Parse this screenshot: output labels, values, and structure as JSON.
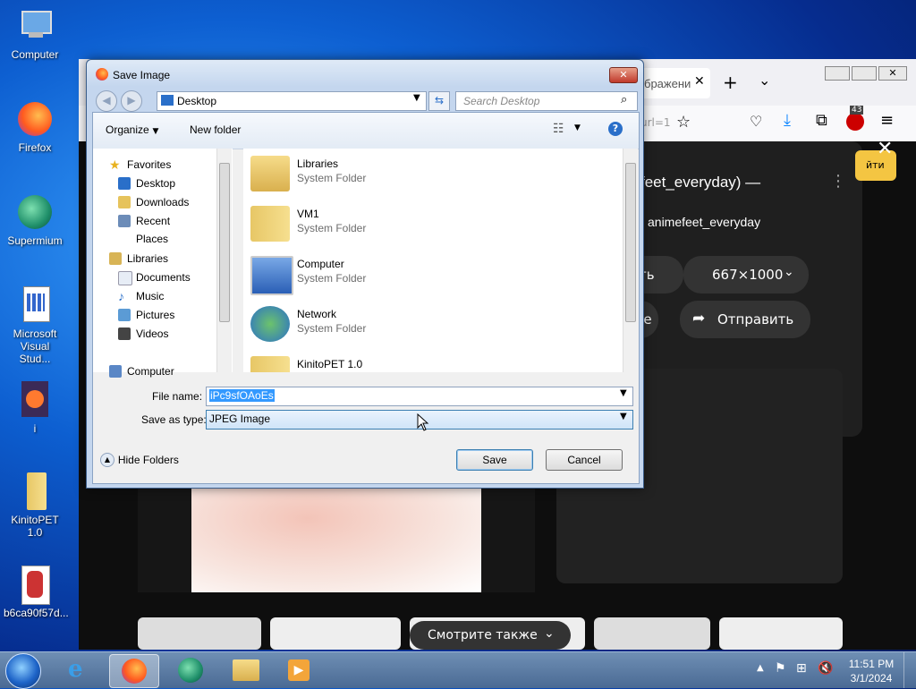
{
  "desktop": {
    "icons": [
      {
        "label": "Computer"
      },
      {
        "label": "Firefox"
      },
      {
        "label": "Supermium"
      },
      {
        "label": "Microsoft Visual Stud..."
      },
      {
        "label": "i"
      },
      {
        "label": "KinitoPET 1.0"
      },
      {
        "label": "b6ca90f57d..."
      }
    ]
  },
  "browser": {
    "tab_label": "бражени",
    "badge_count": "43",
    "url_fragment": "url=1",
    "viewer": {
      "title": "feet_everyday) —",
      "author": "animefeet_everyday",
      "btn_partial": "ть",
      "size_label": "667×1000",
      "share_label": "Отправить",
      "btn_partial2": "ме",
      "top_right": "йти",
      "see_also": "Смотрите также"
    }
  },
  "dialog": {
    "title": "Save Image",
    "address": "Desktop",
    "search_placeholder": "Search Desktop",
    "organize_label": "Organize",
    "new_folder_label": "New folder",
    "nav": {
      "favorites": "Favorites",
      "desktop": "Desktop",
      "downloads": "Downloads",
      "recent": "Recent Places",
      "libraries": "Libraries",
      "documents": "Documents",
      "music": "Music",
      "pictures": "Pictures",
      "videos": "Videos",
      "computer": "Computer"
    },
    "files": [
      {
        "name": "Libraries",
        "type": "System Folder"
      },
      {
        "name": "VM1",
        "type": "System Folder"
      },
      {
        "name": "Computer",
        "type": "System Folder"
      },
      {
        "name": "Network",
        "type": "System Folder"
      },
      {
        "name": "KinitoPET 1.0",
        "type": ""
      }
    ],
    "file_name_label": "File name:",
    "file_name_value": "iPc9sfOAoEs",
    "save_type_label": "Save as type:",
    "save_type_value": "JPEG Image",
    "hide_folders": "Hide Folders",
    "save_btn": "Save",
    "cancel_btn": "Cancel"
  },
  "taskbar": {
    "time": "11:51 PM",
    "date": "3/1/2024"
  },
  "colors": {
    "dialog_frame": "#c4d6ee",
    "selection": "#3399ff",
    "accent_blue": "#1e64c8"
  }
}
